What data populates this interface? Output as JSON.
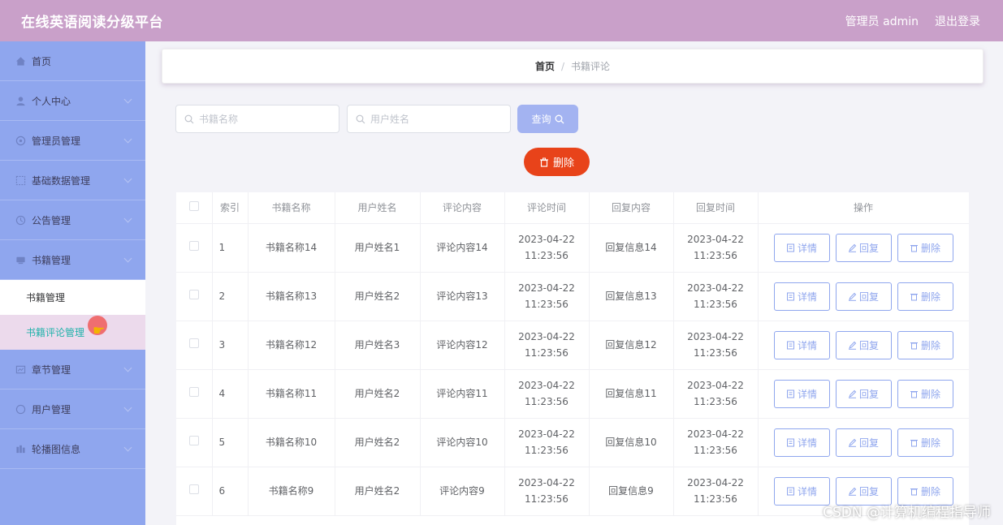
{
  "header": {
    "title": "在线英语阅读分级平台",
    "user_label": "管理员 admin",
    "logout": "退出登录"
  },
  "sidebar": {
    "items": [
      {
        "label": "首页",
        "icon": "home-icon"
      },
      {
        "label": "个人中心",
        "icon": "user-icon"
      },
      {
        "label": "管理员管理",
        "icon": "admin-icon"
      },
      {
        "label": "基础数据管理",
        "icon": "data-icon"
      },
      {
        "label": "公告管理",
        "icon": "notice-icon"
      },
      {
        "label": "书籍管理",
        "icon": "book-icon"
      },
      {
        "label": "章节管理",
        "icon": "chapter-icon"
      },
      {
        "label": "用户管理",
        "icon": "users-icon"
      },
      {
        "label": "轮播图信息",
        "icon": "carousel-icon"
      }
    ],
    "submenu": [
      {
        "label": "书籍管理"
      },
      {
        "label": "书籍评论管理"
      }
    ]
  },
  "breadcrumb": {
    "home": "首页",
    "separator": "/",
    "current": "书籍评论"
  },
  "search": {
    "book_placeholder": "书籍名称",
    "user_placeholder": "用户姓名",
    "query_label": "查询"
  },
  "actions": {
    "delete_label": "删除"
  },
  "table": {
    "headers": [
      "索引",
      "书籍名称",
      "用户姓名",
      "评论内容",
      "评论时间",
      "回复内容",
      "回复时间",
      "操作"
    ],
    "buttons": {
      "detail": "详情",
      "reply": "回复",
      "delete": "删除"
    },
    "rows": [
      {
        "index": "1",
        "book": "书籍名称14",
        "user": "用户姓名1",
        "comment": "评论内容14",
        "comment_time": "2023-04-22 11:23:56",
        "reply": "回复信息14",
        "reply_time": "2023-04-22 11:23:56"
      },
      {
        "index": "2",
        "book": "书籍名称13",
        "user": "用户姓名2",
        "comment": "评论内容13",
        "comment_time": "2023-04-22 11:23:56",
        "reply": "回复信息13",
        "reply_time": "2023-04-22 11:23:56"
      },
      {
        "index": "3",
        "book": "书籍名称12",
        "user": "用户姓名3",
        "comment": "评论内容12",
        "comment_time": "2023-04-22 11:23:56",
        "reply": "回复信息12",
        "reply_time": "2023-04-22 11:23:56"
      },
      {
        "index": "4",
        "book": "书籍名称11",
        "user": "用户姓名2",
        "comment": "评论内容11",
        "comment_time": "2023-04-22 11:23:56",
        "reply": "回复信息11",
        "reply_time": "2023-04-22 11:23:56"
      },
      {
        "index": "5",
        "book": "书籍名称10",
        "user": "用户姓名2",
        "comment": "评论内容10",
        "comment_time": "2023-04-22 11:23:56",
        "reply": "回复信息10",
        "reply_time": "2023-04-22 11:23:56"
      },
      {
        "index": "6",
        "book": "书籍名称9",
        "user": "用户姓名2",
        "comment": "评论内容9",
        "comment_time": "2023-04-22 11:23:56",
        "reply": "回复信息9",
        "reply_time": "2023-04-22 11:23:56"
      }
    ]
  },
  "watermark": "CSDN @计算机编程指导师",
  "colors": {
    "header": "#c9a0c9",
    "sidebar": "#8fa6ee",
    "delete": "#e8431a",
    "active_sub": "#20b2aa"
  }
}
